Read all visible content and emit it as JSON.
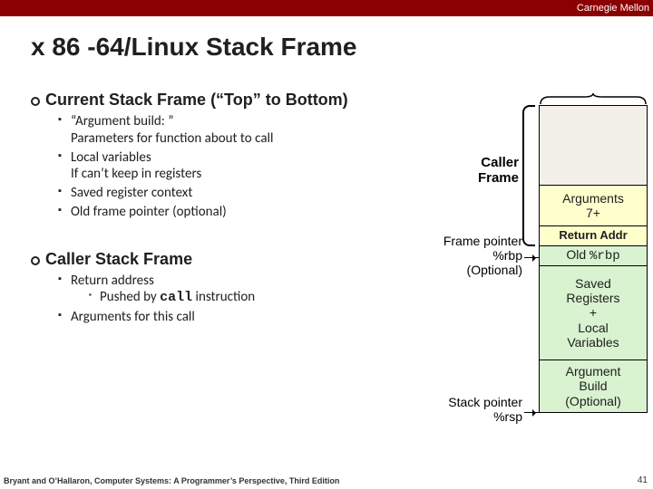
{
  "university": "Carnegie Mellon",
  "title": "x 86 -64/Linux Stack Frame",
  "sec1": {
    "heading": "Current Stack Frame (“Top” to Bottom)",
    "b1": {
      "lead": "“Argument build: ”",
      "rest": "Parameters for function about to call"
    },
    "b2": {
      "lead": "Local variables",
      "rest": "If can’t keep in registers"
    },
    "b3": "Saved register context",
    "b4": "Old frame pointer (optional)"
  },
  "sec2": {
    "heading": "Caller Stack Frame",
    "b1": "Return address",
    "b1a_pre": "Pushed by ",
    "b1a_code": "call",
    "b1a_post": " instruction",
    "b2": "Arguments for this call"
  },
  "diagram": {
    "caller_label": "Caller\nFrame",
    "fp_label": "Frame pointer\n%rbp\n(Optional)",
    "sp_label": "Stack pointer\n%rsp",
    "cells": {
      "args7": "Arguments\n7+",
      "retaddr": "Return Addr",
      "oldrbp_pre": "Old ",
      "oldrbp_code": "%rbp",
      "saved": "Saved\nRegisters\n+\nLocal\nVariables",
      "argbuild": "Argument\nBuild\n(Optional)"
    }
  },
  "footer": "Bryant and O’Hallaron, Computer Systems: A Programmer’s Perspective, Third Edition",
  "page": "41"
}
